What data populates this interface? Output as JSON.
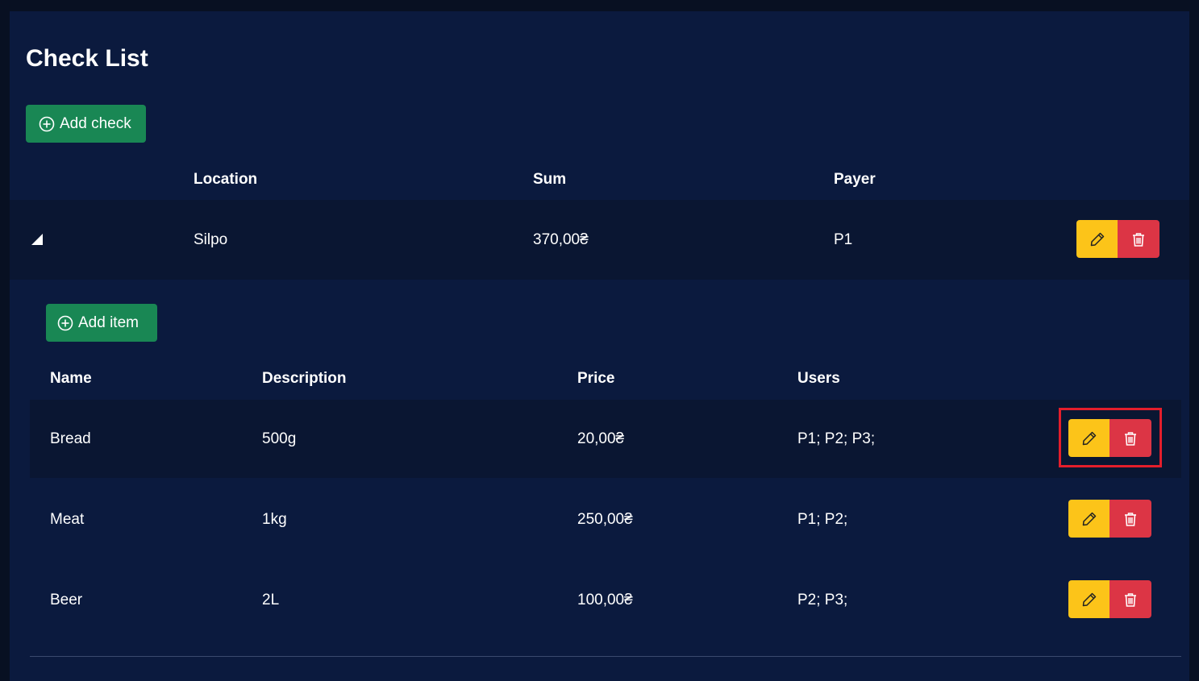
{
  "page": {
    "title": "Check List",
    "add_check_label": "Add check",
    "add_item_label": "Add item"
  },
  "checks_table": {
    "headers": {
      "location": "Location",
      "sum": "Sum",
      "payer": "Payer"
    },
    "rows": [
      {
        "location": "Silpo",
        "sum": "370,00₴",
        "payer": "P1",
        "expanded": true
      }
    ]
  },
  "items_table": {
    "headers": {
      "name": "Name",
      "description": "Description",
      "price": "Price",
      "users": "Users"
    },
    "rows": [
      {
        "name": "Bread",
        "description": "500g",
        "price": "20,00₴",
        "users": "P1; P2; P3;"
      },
      {
        "name": "Meat",
        "description": "1kg",
        "price": "250,00₴",
        "users": "P1; P2;"
      },
      {
        "name": "Beer",
        "description": "2L",
        "price": "100,00₴",
        "users": "P2; P3;"
      }
    ]
  },
  "icons": {
    "add": "plus-circle-icon",
    "edit": "pencil-icon",
    "delete": "trash-icon",
    "expand": "caret-down-right-icon"
  },
  "colors": {
    "background": "#0b1a3e",
    "success": "#198754",
    "warning": "#fcc419",
    "danger": "#dc3545",
    "highlight": "#e41e2b"
  }
}
